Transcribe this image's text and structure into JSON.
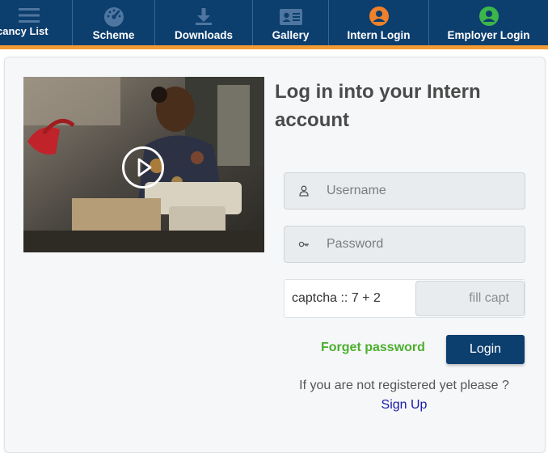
{
  "nav": {
    "items": [
      {
        "label": "cancy List",
        "icon": "menu-icon"
      },
      {
        "label": "Scheme",
        "icon": "gauge-icon"
      },
      {
        "label": "Downloads",
        "icon": "download-icon"
      },
      {
        "label": "Gallery",
        "icon": "id-card-icon"
      },
      {
        "label": "Intern Login",
        "icon": "intern-user-icon"
      },
      {
        "label": "Employer Login",
        "icon": "employer-user-icon"
      }
    ],
    "colors": {
      "bar": "#0c3e6e",
      "accent": "#f39c33",
      "intern_icon": "#f0812a",
      "employer_icon": "#3cb54a"
    }
  },
  "login": {
    "title": "Log in into your Intern account",
    "username_placeholder": "Username",
    "password_placeholder": "Password",
    "captcha_label": "captcha :: 7 + 2",
    "captcha_placeholder": "fill capt",
    "forgot_label": "Forget password",
    "login_label": "Login",
    "not_registered": "If you are not registered yet please ?",
    "signup_label": "Sign Up"
  },
  "video": {
    "icon": "play-icon"
  }
}
